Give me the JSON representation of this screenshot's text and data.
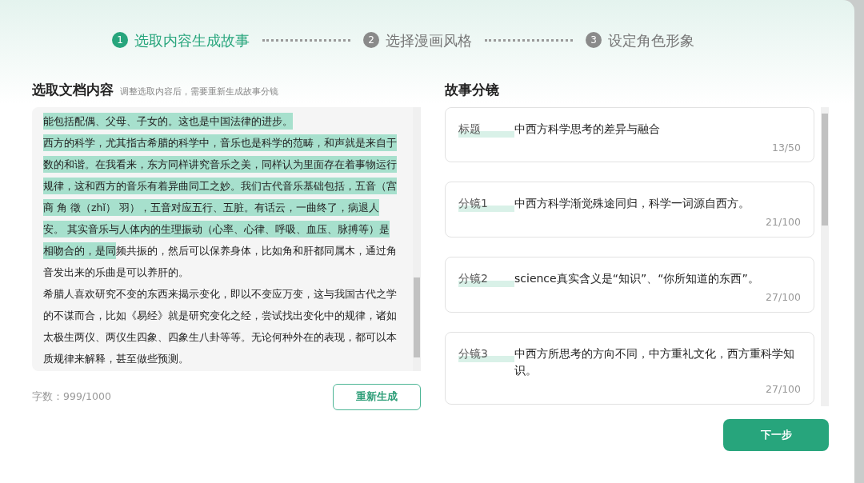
{
  "steps": [
    {
      "number": "1",
      "label": "选取内容生成故事",
      "active": true
    },
    {
      "number": "2",
      "label": "选择漫画风格",
      "active": false
    },
    {
      "number": "3",
      "label": "设定角色形象",
      "active": false
    }
  ],
  "document": {
    "title": "选取文档内容",
    "hint": "调整选取内容后，需要重新生成故事分镜",
    "paragraphs": [
      {
        "segments": [
          {
            "text": "能包括配偶、父母、子女的。这也是中国法律的进步。",
            "selected": true
          }
        ]
      },
      {
        "segments": [
          {
            "text": "西方的科学，尤其指古希腊的科学中，音乐也是科学的范畴，和声就是来自于",
            "selected": true
          }
        ]
      },
      {
        "segments": [
          {
            "text": "数的和谐。在我看来，东方同样讲究音乐之美，同样认为里面存在着事物运行",
            "selected": true
          }
        ]
      },
      {
        "segments": [
          {
            "text": "规律，这和西方的音乐有着异曲同工之妙。我们古代音乐基础包括，五音（宫",
            "selected": true
          }
        ]
      },
      {
        "segments": [
          {
            "text": "商 角 徵（zhǐ） 羽），五音对应五行、五脏。有话云，一曲终了，病退人",
            "selected": true
          }
        ]
      },
      {
        "segments": [
          {
            "text": "安。 其实音乐与人体内的生理振动（心率、心律、呼吸、血压、脉搏等）是",
            "selected": true
          }
        ]
      },
      {
        "segments": [
          {
            "text": "相吻合的，是同",
            "selected": true
          },
          {
            "text": "频共振的，然后可以保养身体，比如角和肝都同属木，通过角",
            "selected": false
          }
        ]
      },
      {
        "segments": [
          {
            "text": "音发出来的乐曲是可以养肝的。",
            "selected": false
          }
        ]
      },
      {
        "segments": [
          {
            "text": "希腊人喜欢研究不变的东西来揭示变化，即以不变应万变，这与我国古代之学",
            "selected": false
          }
        ]
      },
      {
        "segments": [
          {
            "text": "的不谋而合，比如《易经》就是研究变化之经，尝试找出变化中的规律，诸如",
            "selected": false
          }
        ]
      },
      {
        "segments": [
          {
            "text": "太极生两仪、两仪生四象、四象生八卦等等。无论何种外在的表现，都可以本",
            "selected": false
          }
        ]
      },
      {
        "segments": [
          {
            "text": "质规律来解释，甚至做些预测。",
            "selected": false
          }
        ]
      }
    ],
    "word_count": "字数：999/1000",
    "regenerate_button": "重新生成"
  },
  "storyboard": {
    "title": "故事分镜",
    "items": [
      {
        "label": "标题",
        "text": "中西方科学思考的差异与融合",
        "count": "13/50"
      },
      {
        "label": "分镜1",
        "text": "中西方科学渐觉殊途同归，科学一词源自西方。",
        "count": "21/100"
      },
      {
        "label": "分镜2",
        "text": "science真实含义是“知识”、“你所知道的东西”。",
        "count": "27/100"
      },
      {
        "label": "分镜3",
        "text": "中西方所思考的方向不同，中方重礼文化，西方重科学知识。",
        "count": "27/100"
      }
    ]
  },
  "next_button": "下一步"
}
